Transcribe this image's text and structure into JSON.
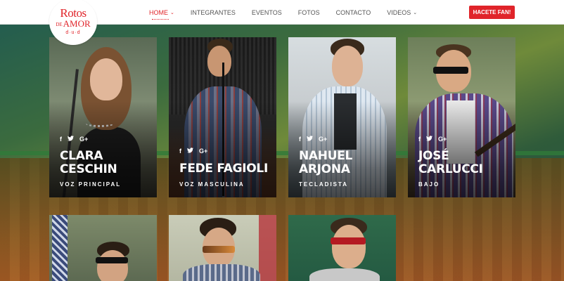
{
  "header": {
    "logo": {
      "line1": "Rotos",
      "line2_small": "DE",
      "line2": "AMOR",
      "tagline": "d·u·d"
    },
    "nav": [
      {
        "label": "HOME",
        "has_dropdown": true,
        "active": true
      },
      {
        "label": "INTEGRANTES",
        "has_dropdown": false,
        "active": false
      },
      {
        "label": "EVENTOS",
        "has_dropdown": false,
        "active": false
      },
      {
        "label": "FOTOS",
        "has_dropdown": false,
        "active": false
      },
      {
        "label": "CONTACTO",
        "has_dropdown": false,
        "active": false
      },
      {
        "label": "VIDEOS",
        "has_dropdown": true,
        "active": false
      }
    ],
    "cta": "HACETE FAN!"
  },
  "members": [
    {
      "name_line1": "CLARA",
      "name_line2": "CESCHIN",
      "role": "VOZ PRINCIPAL"
    },
    {
      "name_line1": "FEDE FAGIOLI",
      "name_line2": "",
      "role": "VOZ MASCULINA"
    },
    {
      "name_line1": "NAHUEL",
      "name_line2": "ARJONA",
      "role": "TECLADISTA"
    },
    {
      "name_line1": "JOSÉ",
      "name_line2": "CARLUCCI",
      "role": "BAJO"
    }
  ],
  "social_icons": {
    "facebook": "f",
    "twitter": "twitter-icon",
    "google_plus": "G+"
  },
  "colors": {
    "accent": "#e0242a",
    "nav_text": "#555555"
  }
}
